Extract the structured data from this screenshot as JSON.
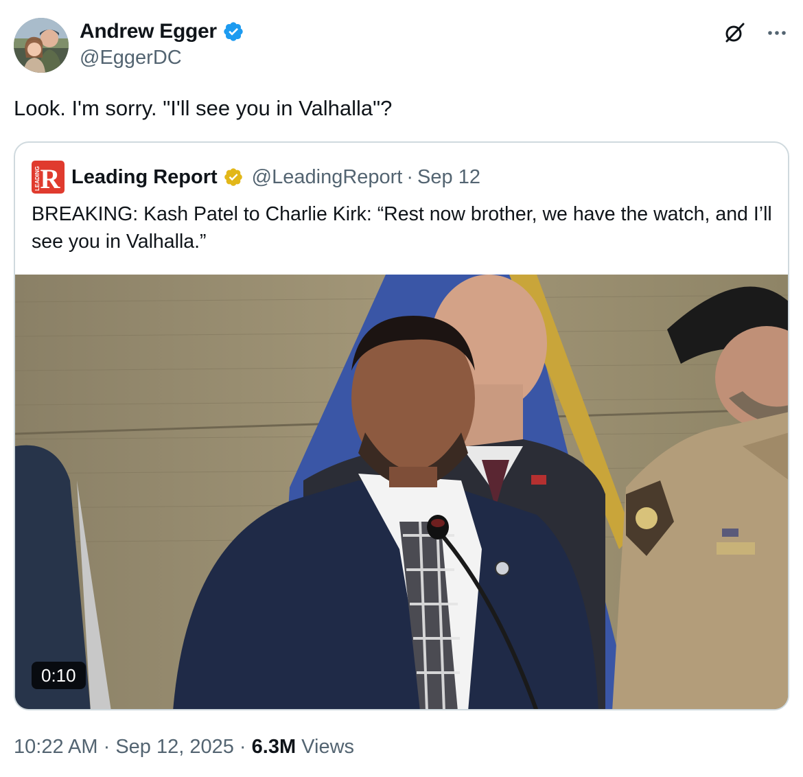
{
  "author": {
    "name": "Andrew Egger",
    "handle": "@EggerDC",
    "verified": true,
    "verified_color": "#1d9bf0"
  },
  "tweet": {
    "text": "Look. I'm sorry. \"I'll see you in Valhalla\"?"
  },
  "top_actions": {
    "grok_icon": "grok-icon",
    "more_icon": "more-horizontal-icon"
  },
  "quote": {
    "name": "Leading Report",
    "handle": "@LeadingReport",
    "separator": "·",
    "date": "Sep 12",
    "verified_color": "#e2b719",
    "logo_letter": "R",
    "logo_caption": "LEADING",
    "logo_color": "#e03b2e",
    "text": "BREAKING: Kash Patel to Charlie Kirk: “Rest now brother, we have the watch, and I’ll see you in Valhalla.”",
    "video": {
      "duration": "0:10"
    }
  },
  "footer": {
    "time": "10:22 AM",
    "sep1": " · ",
    "date": "Sep 12, 2025",
    "sep2": " · ",
    "views_count": "6.3M",
    "views_label": " Views"
  }
}
